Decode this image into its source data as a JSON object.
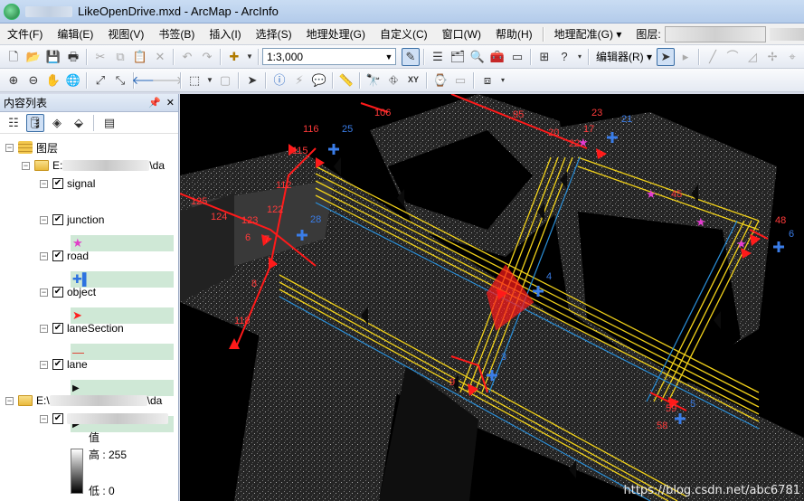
{
  "window": {
    "title": "LikeOpenDrive.mxd - ArcMap - ArcInfo"
  },
  "menu": {
    "items": [
      "文件(F)",
      "编辑(E)",
      "视图(V)",
      "书签(B)",
      "插入(I)",
      "选择(S)",
      "地理处理(G)",
      "自定义(C)",
      "窗口(W)",
      "帮助(H)"
    ],
    "georef": "地理配准(G) ▾",
    "layer_label": "图层:"
  },
  "toolbar": {
    "scale": "1:3,000",
    "editor": "编辑器(R) ▾"
  },
  "toc": {
    "title": "内容列表",
    "controls": [
      "📌",
      "✕"
    ],
    "root_label": "图层",
    "folder1_suffix": "\\da",
    "folder2_prefix": "E:\\",
    "folder2_suffix": "\\da",
    "folder1_prefix": "E:",
    "layers": [
      {
        "name": "signal",
        "symbol": "★",
        "color": "#e040c8"
      },
      {
        "name": "junction",
        "symbol": "✚▌",
        "color": "#2d72e0"
      },
      {
        "name": "road",
        "symbol": "➤",
        "color": "#ff2020"
      },
      {
        "name": "object",
        "symbol": "—",
        "color": "#e03020"
      },
      {
        "name": "laneSection",
        "symbol": "▶",
        "color": "#111111"
      },
      {
        "name": "lane",
        "symbol": "▶",
        "color": "#111111"
      }
    ],
    "raster_value_label": "值",
    "raster_high": "高 : 255",
    "raster_low": "低 : 0"
  },
  "map": {
    "road_labels": [
      "116",
      "25",
      "106",
      "95",
      "20",
      "22",
      "17",
      "23",
      "21",
      "115",
      "112",
      "125",
      "124",
      "123",
      "122",
      "6",
      "7",
      "8",
      "118",
      "48",
      "6",
      "45",
      "4",
      "4",
      "3",
      "9",
      "5",
      "59",
      "58",
      "5",
      "1",
      "15"
    ],
    "junction_labels": [
      "25",
      "21",
      "28",
      "4",
      "3",
      "5",
      "6"
    ],
    "watermark": "https://blog.csdn.net/abc6781"
  },
  "colors": {
    "road": "#ff1a1a",
    "lane": "#f2d21a",
    "lane_edge": "#2a8fd8",
    "junction": "#3a7de8",
    "signal": "#e53dd1"
  }
}
